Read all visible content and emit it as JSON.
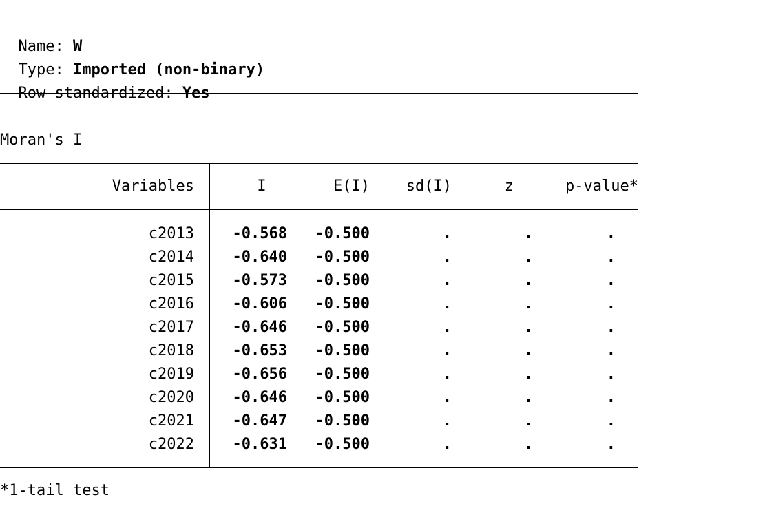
{
  "header": {
    "name_label": "Name: ",
    "name_value": "W",
    "type_label": "Type: ",
    "type_value": "Imported (non-binary)",
    "rowstd_label": "Row-standardized: ",
    "rowstd_value": "Yes"
  },
  "section_title": "Moran's I",
  "table": {
    "columns": [
      "Variables",
      "I",
      "E(I)",
      "sd(I)",
      "z",
      "p-value*"
    ],
    "rows": [
      {
        "variable": "c2013",
        "I": "-0.568",
        "EI": "-0.500",
        "sd": ".",
        "z": ".",
        "p": "."
      },
      {
        "variable": "c2014",
        "I": "-0.640",
        "EI": "-0.500",
        "sd": ".",
        "z": ".",
        "p": "."
      },
      {
        "variable": "c2015",
        "I": "-0.573",
        "EI": "-0.500",
        "sd": ".",
        "z": ".",
        "p": "."
      },
      {
        "variable": "c2016",
        "I": "-0.606",
        "EI": "-0.500",
        "sd": ".",
        "z": ".",
        "p": "."
      },
      {
        "variable": "c2017",
        "I": "-0.646",
        "EI": "-0.500",
        "sd": ".",
        "z": ".",
        "p": "."
      },
      {
        "variable": "c2018",
        "I": "-0.653",
        "EI": "-0.500",
        "sd": ".",
        "z": ".",
        "p": "."
      },
      {
        "variable": "c2019",
        "I": "-0.656",
        "EI": "-0.500",
        "sd": ".",
        "z": ".",
        "p": "."
      },
      {
        "variable": "c2020",
        "I": "-0.646",
        "EI": "-0.500",
        "sd": ".",
        "z": ".",
        "p": "."
      },
      {
        "variable": "c2021",
        "I": "-0.647",
        "EI": "-0.500",
        "sd": ".",
        "z": ".",
        "p": "."
      },
      {
        "variable": "c2022",
        "I": "-0.631",
        "EI": "-0.500",
        "sd": ".",
        "z": ".",
        "p": "."
      }
    ]
  },
  "footnote": "*1-tail test"
}
